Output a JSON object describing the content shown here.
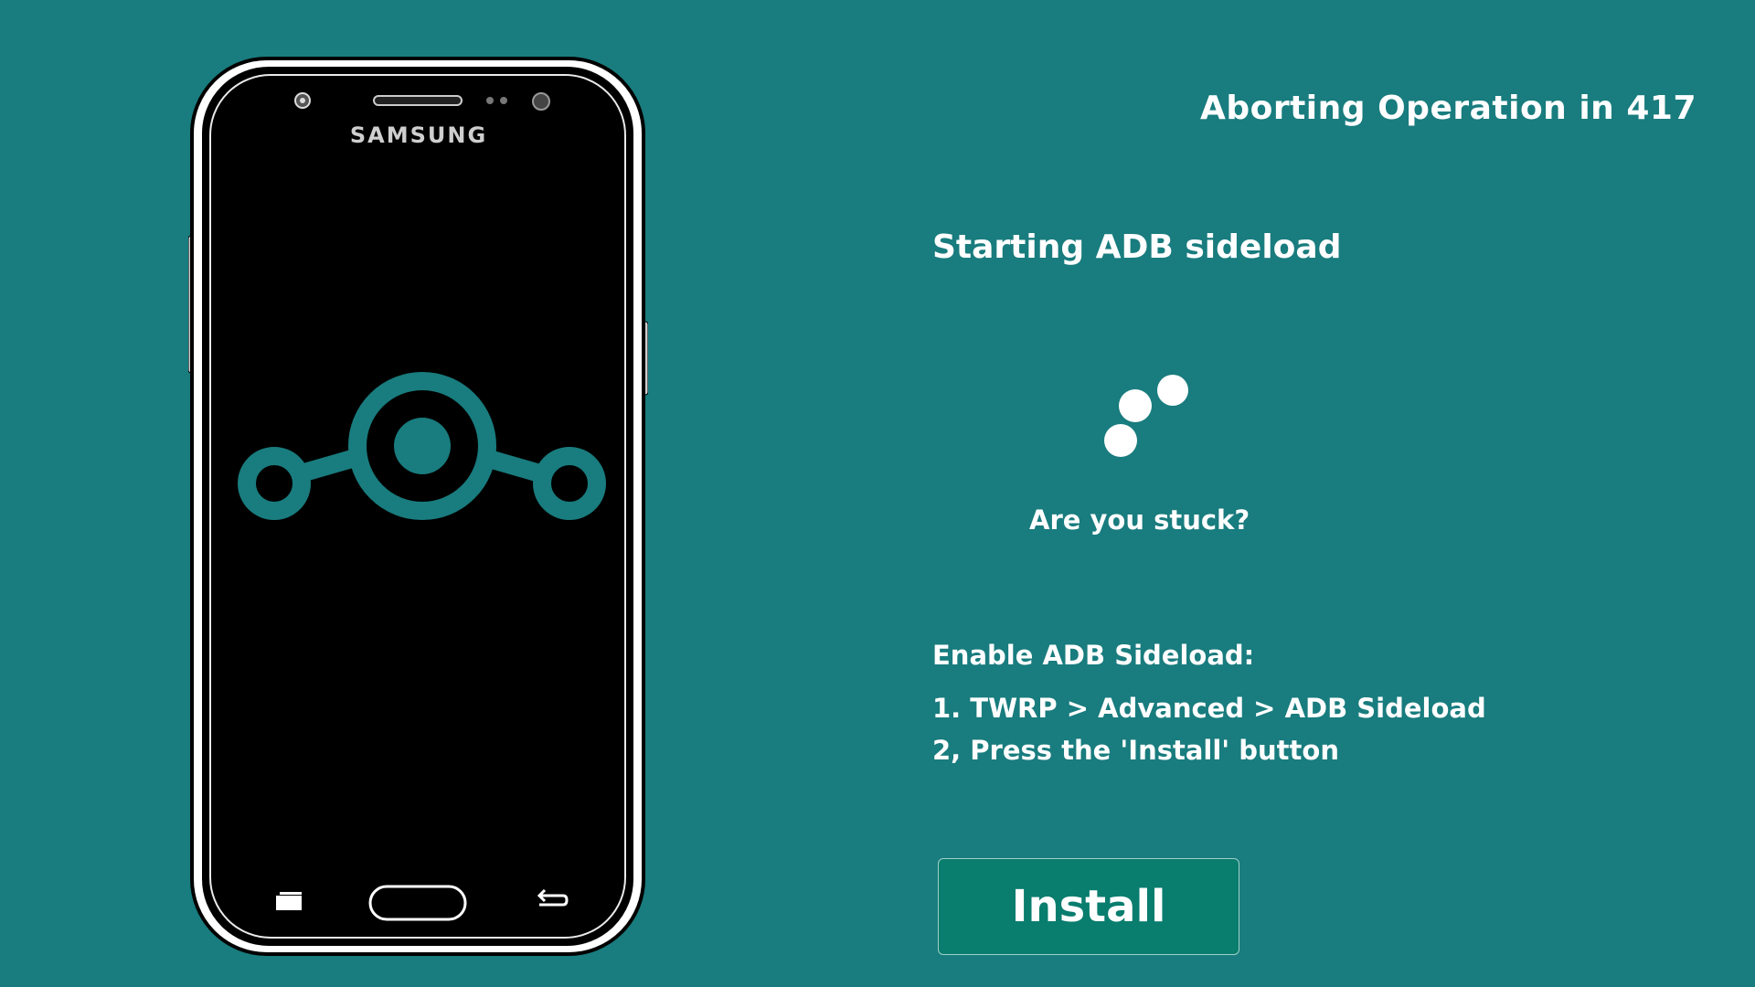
{
  "phone": {
    "brand": "SAMSUNG",
    "screen_logo": "lineageos-logo-icon"
  },
  "header": {
    "countdown": "Aborting Operation in 417"
  },
  "status": {
    "title": "Starting ADB sideload",
    "spinner": "loading-spinner-icon",
    "stuck_link": "Are you stuck?"
  },
  "instructions": {
    "heading": "Enable ADB Sideload:",
    "steps": [
      "1. TWRP > Advanced > ADB Sideload",
      "2, Press the 'Install' button"
    ]
  },
  "actions": {
    "install_label": "Install"
  },
  "colors": {
    "background": "#197c7e",
    "logo": "#197c7e",
    "button": "#097d6e",
    "text": "#ffffff"
  }
}
